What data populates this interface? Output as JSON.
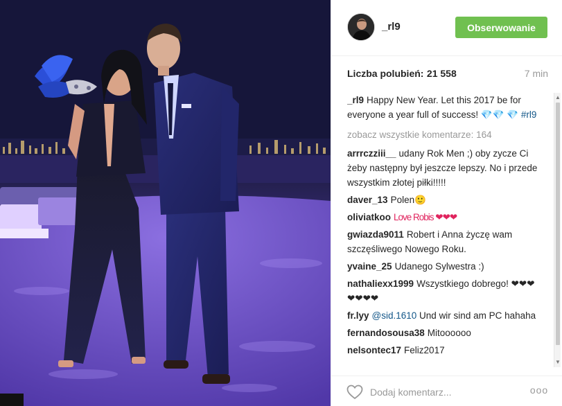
{
  "post": {
    "username": "_rl9",
    "follow_label": "Obserwowanie",
    "likes_label": "Liczba polubień:",
    "likes_count": "21 558",
    "time": "7 min",
    "caption_user": "_rl9",
    "caption_text": "Happy New Year. Let this 2017 be for everyone a year full of success!",
    "caption_emoji": "💎💎 💎",
    "caption_tag": "#rl9",
    "view_all": "zobacz wszystkie komentarze: 164"
  },
  "comments": [
    {
      "user": "arrrczziii__",
      "text": "udany Rok Men ;) oby zycze Ci żeby następny był jeszcze lepszy. No i przede wszystkim złotej piłki!!!!!"
    },
    {
      "user": "daver_13",
      "text": "Polen🙂"
    },
    {
      "user": "oliviatkoo",
      "text": "Love Robis ❤❤❤"
    },
    {
      "user": "gwiazda9011",
      "text": "Robert i Anna życzę wam szczęśliwego Nowego Roku."
    },
    {
      "user": "yvaine_25",
      "text": "Udanego Sylwestra :)"
    },
    {
      "user": "nathaliexx1999",
      "text": "Wszystkiego dobrego! ❤❤❤❤❤❤❤"
    },
    {
      "user": "fr.lyy",
      "mention": "@sid.1610",
      "text": "Und wir sind am PC hahaha"
    },
    {
      "user": "fernandosousa38",
      "text": "Mitoooooo"
    },
    {
      "user": "nelsontec17",
      "text": "Feliz2017"
    }
  ],
  "footer": {
    "comment_placeholder": "Dodaj komentarz...",
    "more_label": "ooo"
  },
  "icons": {
    "like": "heart-outline-icon",
    "more": "more-options-icon"
  },
  "colors": {
    "follow_button": "#70c050",
    "link": "#125688",
    "muted": "#999999"
  }
}
